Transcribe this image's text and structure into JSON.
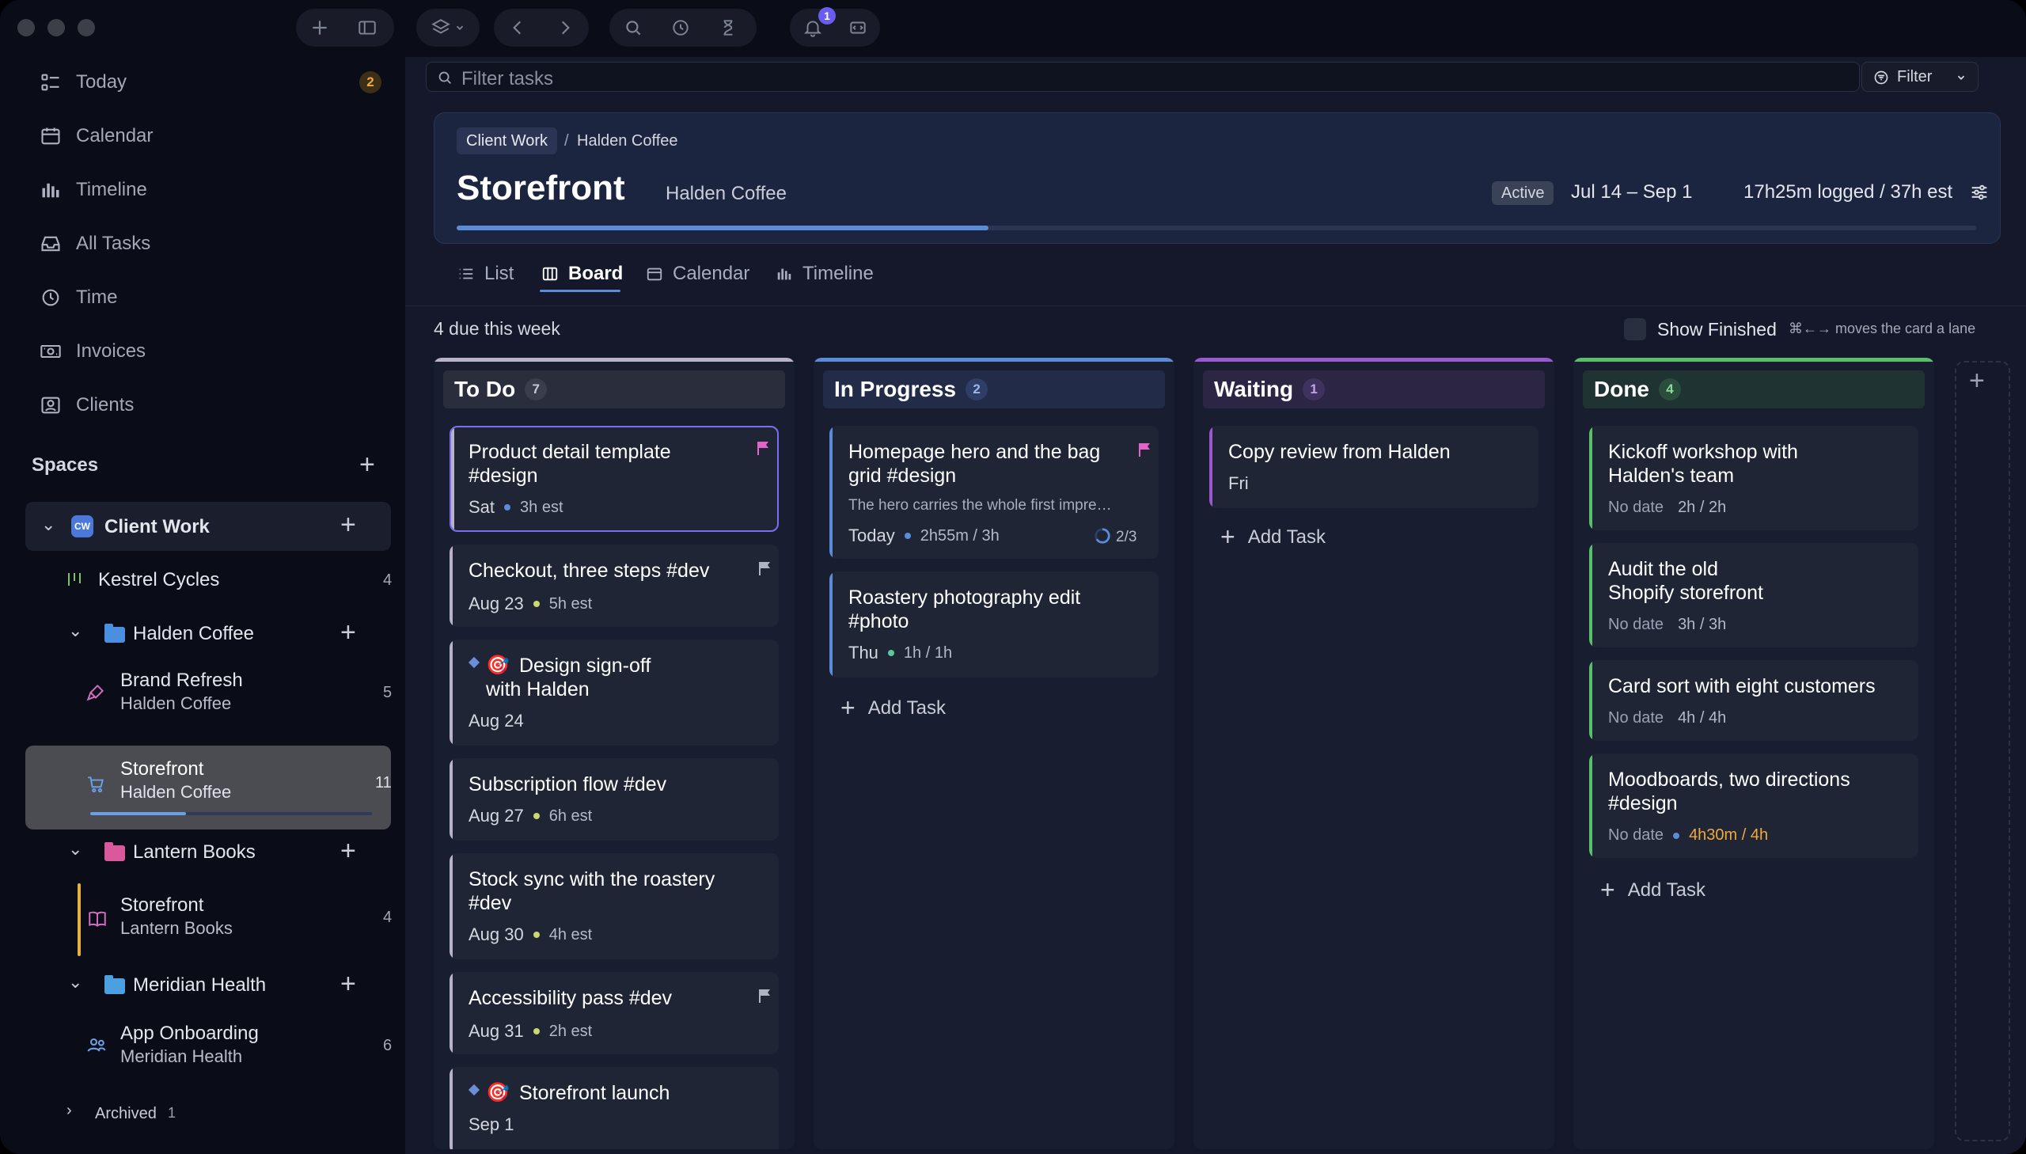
{
  "toolbar": {
    "notification_count": "1"
  },
  "search": {
    "placeholder": "Filter tasks"
  },
  "filter": {
    "label": "Filter"
  },
  "nav": {
    "today": "Today",
    "today_badge": "2",
    "calendar": "Calendar",
    "timeline": "Timeline",
    "all_tasks": "All Tasks",
    "time": "Time",
    "invoices": "Invoices",
    "clients": "Clients"
  },
  "spaces": {
    "heading": "Spaces",
    "client_work": {
      "badge": "CW",
      "label": "Client Work"
    },
    "kestrel": {
      "label": "Kestrel Cycles",
      "count": "4"
    },
    "halden_folder": {
      "label": "Halden Coffee"
    },
    "brand_refresh": {
      "title": "Brand Refresh",
      "sub": "Halden Coffee",
      "count": "5"
    },
    "storefront_halden": {
      "title": "Storefront",
      "sub": "Halden Coffee",
      "count": "11",
      "progress": 0.34
    },
    "lantern_folder": {
      "label": "Lantern Books"
    },
    "storefront_lantern": {
      "title": "Storefront",
      "sub": "Lantern Books",
      "count": "4"
    },
    "meridian_folder": {
      "label": "Meridian Health"
    },
    "app_onboarding": {
      "title": "App Onboarding",
      "sub": "Meridian Health",
      "count": "6"
    },
    "archived": {
      "label": "Archived",
      "count": "1"
    }
  },
  "project": {
    "breadcrumb_parent": "Client Work",
    "breadcrumb_current": "Halden Coffee",
    "title": "Storefront",
    "client": "Halden Coffee",
    "status": "Active",
    "dates": "Jul 14 – Sep 1",
    "logged": "17h25m logged / 37h est",
    "progress": 0.35
  },
  "views": {
    "list": "List",
    "board": "Board",
    "calendar": "Calendar",
    "timeline": "Timeline"
  },
  "board": {
    "due_summary": "4 due this week",
    "show_finished": "Show Finished",
    "hint": "⌘←→ moves the card a lane",
    "add_task": "Add Task"
  },
  "columns": {
    "todo": {
      "name": "To Do",
      "count": "7",
      "cards": [
        {
          "title": "Product detail template #design",
          "date": "Sat",
          "est": "3h est"
        },
        {
          "title": "Checkout, three steps #dev",
          "date": "Aug 23",
          "est": "5h est"
        },
        {
          "title_a": "Design sign-off",
          "title_b": "with Halden",
          "date": "Aug 24"
        },
        {
          "title": "Subscription flow #dev",
          "date": "Aug 27",
          "est": "6h est"
        },
        {
          "title": "Stock sync with the roastery #dev",
          "date": "Aug 30",
          "est": "4h est"
        },
        {
          "title": "Accessibility pass #dev",
          "date": "Aug 31",
          "est": "2h est"
        },
        {
          "title": "Storefront launch",
          "date": "Sep 1"
        }
      ]
    },
    "progress": {
      "name": "In Progress",
      "count": "2",
      "cards": [
        {
          "title": "Homepage hero and the bag grid #design",
          "desc": "The hero carries the whole first impre…",
          "date": "Today",
          "est": "2h55m / 3h",
          "subtasks": "2/3"
        },
        {
          "title": "Roastery photography edit #photo",
          "date": "Thu",
          "est": "1h / 1h"
        }
      ]
    },
    "waiting": {
      "name": "Waiting",
      "count": "1",
      "cards": [
        {
          "title": "Copy review from Halden",
          "date": "Fri"
        }
      ]
    },
    "done": {
      "name": "Done",
      "count": "4",
      "cards": [
        {
          "title": "Kickoff workshop with Halden's team",
          "date": "No date",
          "est": "2h / 2h"
        },
        {
          "title_a": "Audit the old",
          "title_b": "Shopify storefront",
          "date": "No date",
          "est": "3h / 3h"
        },
        {
          "title": "Card sort with eight customers",
          "date": "No date",
          "est": "4h / 4h"
        },
        {
          "title": "Moodboards, two directions #design",
          "date": "No date",
          "est": "4h30m / 4h"
        }
      ]
    }
  },
  "colors": {
    "todo": "#b8b3c8",
    "progress": "#5b8bd9",
    "waiting": "#9b59d0",
    "done": "#59c06a",
    "flag_pink": "#e264c8",
    "flag_gray": "#8c90a0",
    "over_budget": "#f0a93a"
  }
}
